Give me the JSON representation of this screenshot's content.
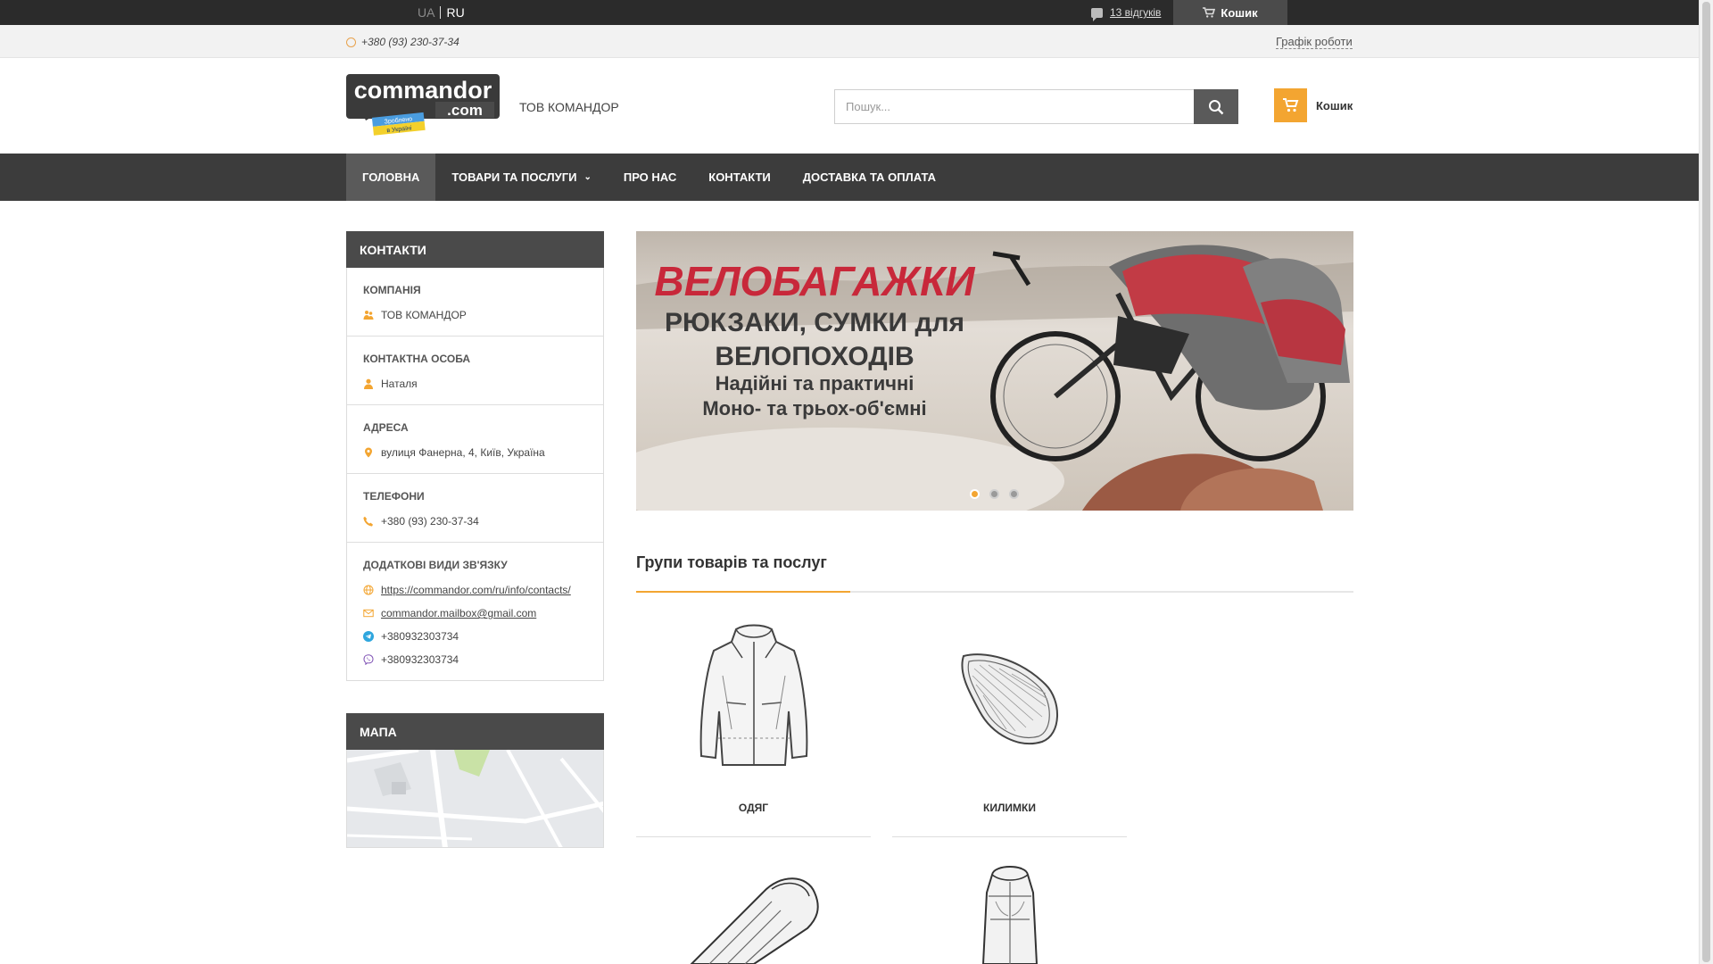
{
  "topbar": {
    "lang_ua": "UA",
    "lang_ru": "RU",
    "reviews_link": "13 відгуків",
    "cart_label": "Кошик"
  },
  "strip": {
    "phone": "+380 (93) 230-37-34",
    "schedule": "Графік роботи"
  },
  "header": {
    "company_name": "ТОВ КОМАНДОР",
    "search_placeholder": "Пошук...",
    "cart_label": "Кошик",
    "logo_text": "commandor",
    "logo_domain": ".com",
    "logo_badge": "Зроблено в Україні"
  },
  "nav": {
    "items": [
      {
        "label": "ГОЛОВНА"
      },
      {
        "label": "ТОВАРИ ТА ПОСЛУГИ"
      },
      {
        "label": "ПРО НАС"
      },
      {
        "label": "КОНТАКТИ"
      },
      {
        "label": "ДОСТАВКА ТА ОПЛАТА"
      }
    ]
  },
  "sidebar": {
    "title": "КОНТАКТИ",
    "company_heading": "КОМПАНІЯ",
    "company_value": "ТОВ КОМАНДОР",
    "person_heading": "КОНТАКТНА ОСОБА",
    "person_value": "Наталя",
    "address_heading": "АДРЕСА",
    "address_value": "вулиця Фанерна, 4, Київ, Україна",
    "phones_heading": "ТЕЛЕФОНИ",
    "phone_value": "+380 (93) 230-37-34",
    "extra_heading": "ДОДАТКОВІ ВИДИ ЗВ'ЯЗКУ",
    "site_link": "https://commandor.com/ru/info/contacts/",
    "email_link": "commandor.mailbox@gmail.com",
    "telegram": "+380932303734",
    "viber": "+380932303734",
    "map_title": "МАПА"
  },
  "banner": {
    "line1": "ВЕЛОБАГАЖКИ",
    "line2": "РЮКЗАКИ, СУМКИ для",
    "line3": "ВЕЛОПОХОДІВ",
    "line4": "Надійні та практичні",
    "line5": "Моно- та трьох-об'ємні",
    "slides_total": 3,
    "active_slide": 1
  },
  "groups": {
    "title": "Групи товарів та послуг",
    "cards": [
      {
        "label": "ОДЯГ",
        "icon": "jacket-icon"
      },
      {
        "label": "КИЛИМКИ",
        "icon": "sleeping-mat-icon"
      }
    ],
    "cards_row2": [
      {
        "icon": "sleeping-bag-icon"
      },
      {
        "icon": "backpack-icon"
      }
    ]
  },
  "colors": {
    "accent": "#f3a531",
    "nav_bg": "#3c3c3c",
    "topbar_bg": "#2b2b2b"
  }
}
